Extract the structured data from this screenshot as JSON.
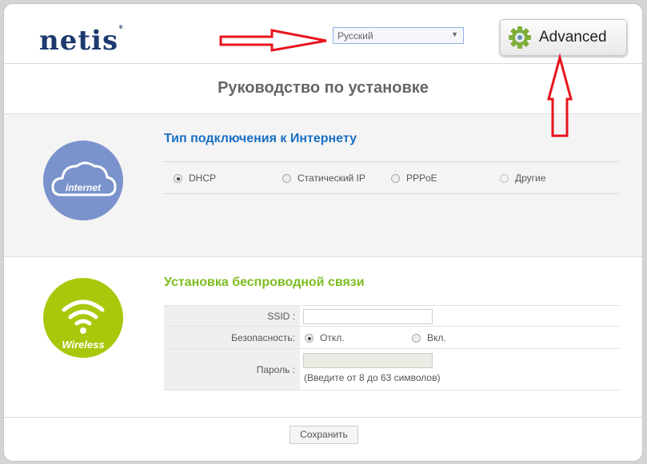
{
  "header": {
    "logo": "netis",
    "language": "Русский",
    "advanced_label": "Advanced"
  },
  "title": "Руководство по установке",
  "internet": {
    "icon_label": "internet",
    "heading": "Тип подключения к Интернету",
    "options": [
      "DHCP",
      "Статический IP",
      "PPPoE",
      "Другие"
    ],
    "selected": "DHCP"
  },
  "wireless": {
    "icon_label": "Wireless",
    "heading": "Установка беспроводной связи",
    "ssid_label": "SSID :",
    "ssid_value": "",
    "security_label": "Безопасность:",
    "security_off": "Откл.",
    "security_on": "Вкл.",
    "password_label": "Пароль :",
    "password_hint": "(Введите от 8 до 63 символов)"
  },
  "save_label": "Сохранить",
  "colors": {
    "internet": "#7b93cc",
    "wireless": "#a9c80c",
    "heading_blue": "#1a6fc4",
    "heading_green": "#7cbd1f",
    "arrow": "#e8141c"
  }
}
